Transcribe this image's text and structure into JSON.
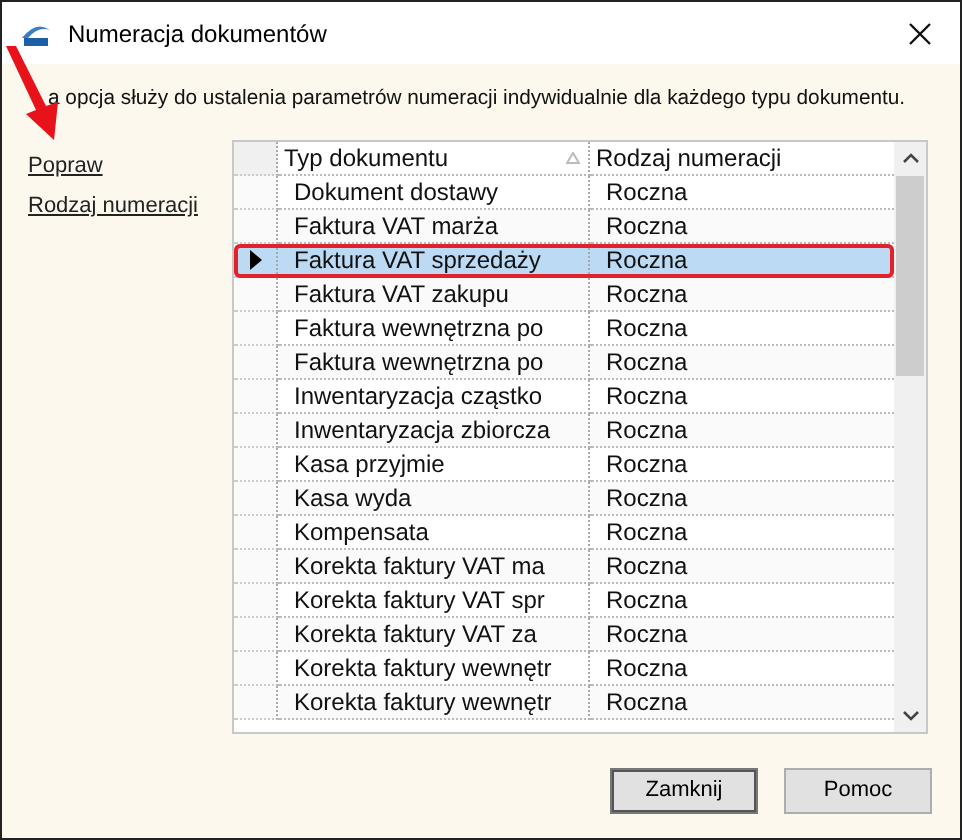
{
  "window": {
    "title": "Numeracja dokumentów"
  },
  "description": "a opcja służy do ustalenia parametrów numeracji indywidualnie dla każdego typu dokumentu.",
  "links": [
    "Popraw",
    "Rodzaj numeracji"
  ],
  "table": {
    "columns": [
      "Typ dokumentu",
      "Rodzaj numeracji"
    ],
    "rows": [
      {
        "type": "Dokument dostawy",
        "numbering": "Roczna",
        "selected": false
      },
      {
        "type": "Faktura VAT marża",
        "numbering": "Roczna",
        "selected": false
      },
      {
        "type": "Faktura VAT sprzedaży",
        "numbering": "Roczna",
        "selected": true
      },
      {
        "type": "Faktura VAT zakupu",
        "numbering": "Roczna",
        "selected": false
      },
      {
        "type": "Faktura wewnętrzna po",
        "numbering": "Roczna",
        "selected": false
      },
      {
        "type": "Faktura wewnętrzna po",
        "numbering": "Roczna",
        "selected": false
      },
      {
        "type": "Inwentaryzacja cząstko",
        "numbering": "Roczna",
        "selected": false
      },
      {
        "type": "Inwentaryzacja zbiorcza",
        "numbering": "Roczna",
        "selected": false
      },
      {
        "type": "Kasa przyjmie",
        "numbering": "Roczna",
        "selected": false
      },
      {
        "type": "Kasa wyda",
        "numbering": "Roczna",
        "selected": false
      },
      {
        "type": "Kompensata",
        "numbering": "Roczna",
        "selected": false
      },
      {
        "type": "Korekta faktury VAT ma",
        "numbering": "Roczna",
        "selected": false
      },
      {
        "type": "Korekta faktury VAT spr",
        "numbering": "Roczna",
        "selected": false
      },
      {
        "type": "Korekta faktury VAT za",
        "numbering": "Roczna",
        "selected": false
      },
      {
        "type": "Korekta faktury wewnętr",
        "numbering": "Roczna",
        "selected": false
      },
      {
        "type": "Korekta faktury wewnętr",
        "numbering": "Roczna",
        "selected": false
      }
    ]
  },
  "buttons": [
    "Zamknij",
    "Pomoc"
  ]
}
